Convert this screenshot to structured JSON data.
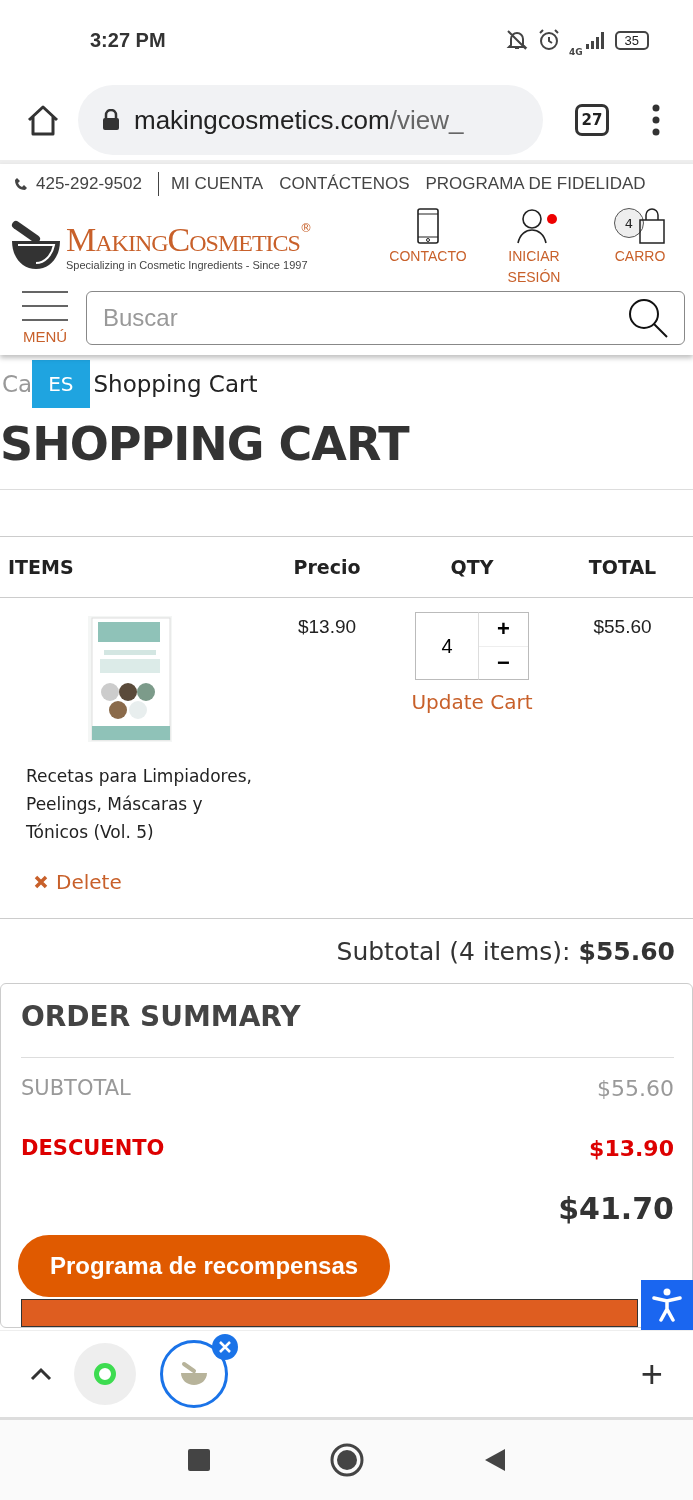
{
  "status_bar": {
    "time": "3:27 PM",
    "network": "4G",
    "battery": "35"
  },
  "browser": {
    "url_domain": "makingcosmetics.com",
    "url_path": "/view_",
    "tab_count": "27"
  },
  "top_links": {
    "phone": "425-292-9502",
    "links": [
      "MI CUENTA",
      "CONTÁCTENOS",
      "PROGRAMA DE FIDELIDAD"
    ]
  },
  "logo": {
    "name": "MakingCosmetics",
    "mark": "®",
    "tagline": "Specializing in Cosmetic Ingredients - Since 1997"
  },
  "header_actions": [
    {
      "kind": "phone",
      "label": "CONTACTO"
    },
    {
      "kind": "user",
      "label": "INICIAR SESIÓN",
      "notification": true
    },
    {
      "kind": "cart",
      "label": "CARRO",
      "count": "4"
    }
  ],
  "menu_label": "MENÚ",
  "search": {
    "placeholder": "Buscar"
  },
  "breadcrumb": {
    "visible_start": "Ca",
    "current": "Shopping Cart"
  },
  "language_badge": "ES",
  "page_title": "SHOPPING CART",
  "table": {
    "columns": [
      "ITEMS",
      "Precio",
      "QTY",
      "TOTAL"
    ],
    "rows": [
      {
        "name": "Recetas para Limpiadores, Peelings, Máscaras y Tónicos (Vol. 5)",
        "price": "$13.90",
        "qty": "4",
        "total": "$55.60",
        "plus": "+",
        "minus": "−",
        "update": "Update Cart",
        "delete": "Delete"
      }
    ]
  },
  "subtotal": {
    "label": "Subtotal (4 items):",
    "value": "$55.60"
  },
  "order_summary": {
    "title": "ORDER SUMMARY",
    "rows": [
      {
        "kind": "normal",
        "label": "SUBTOTAL",
        "value": "$55.60"
      },
      {
        "kind": "discount",
        "label": "DESCUENTO",
        "value": "$13.90"
      },
      {
        "kind": "total",
        "value": "$41.70"
      }
    ]
  },
  "rewards_button": "Programa de recompensas",
  "bottom_bar": {
    "new_tab": "+"
  }
}
